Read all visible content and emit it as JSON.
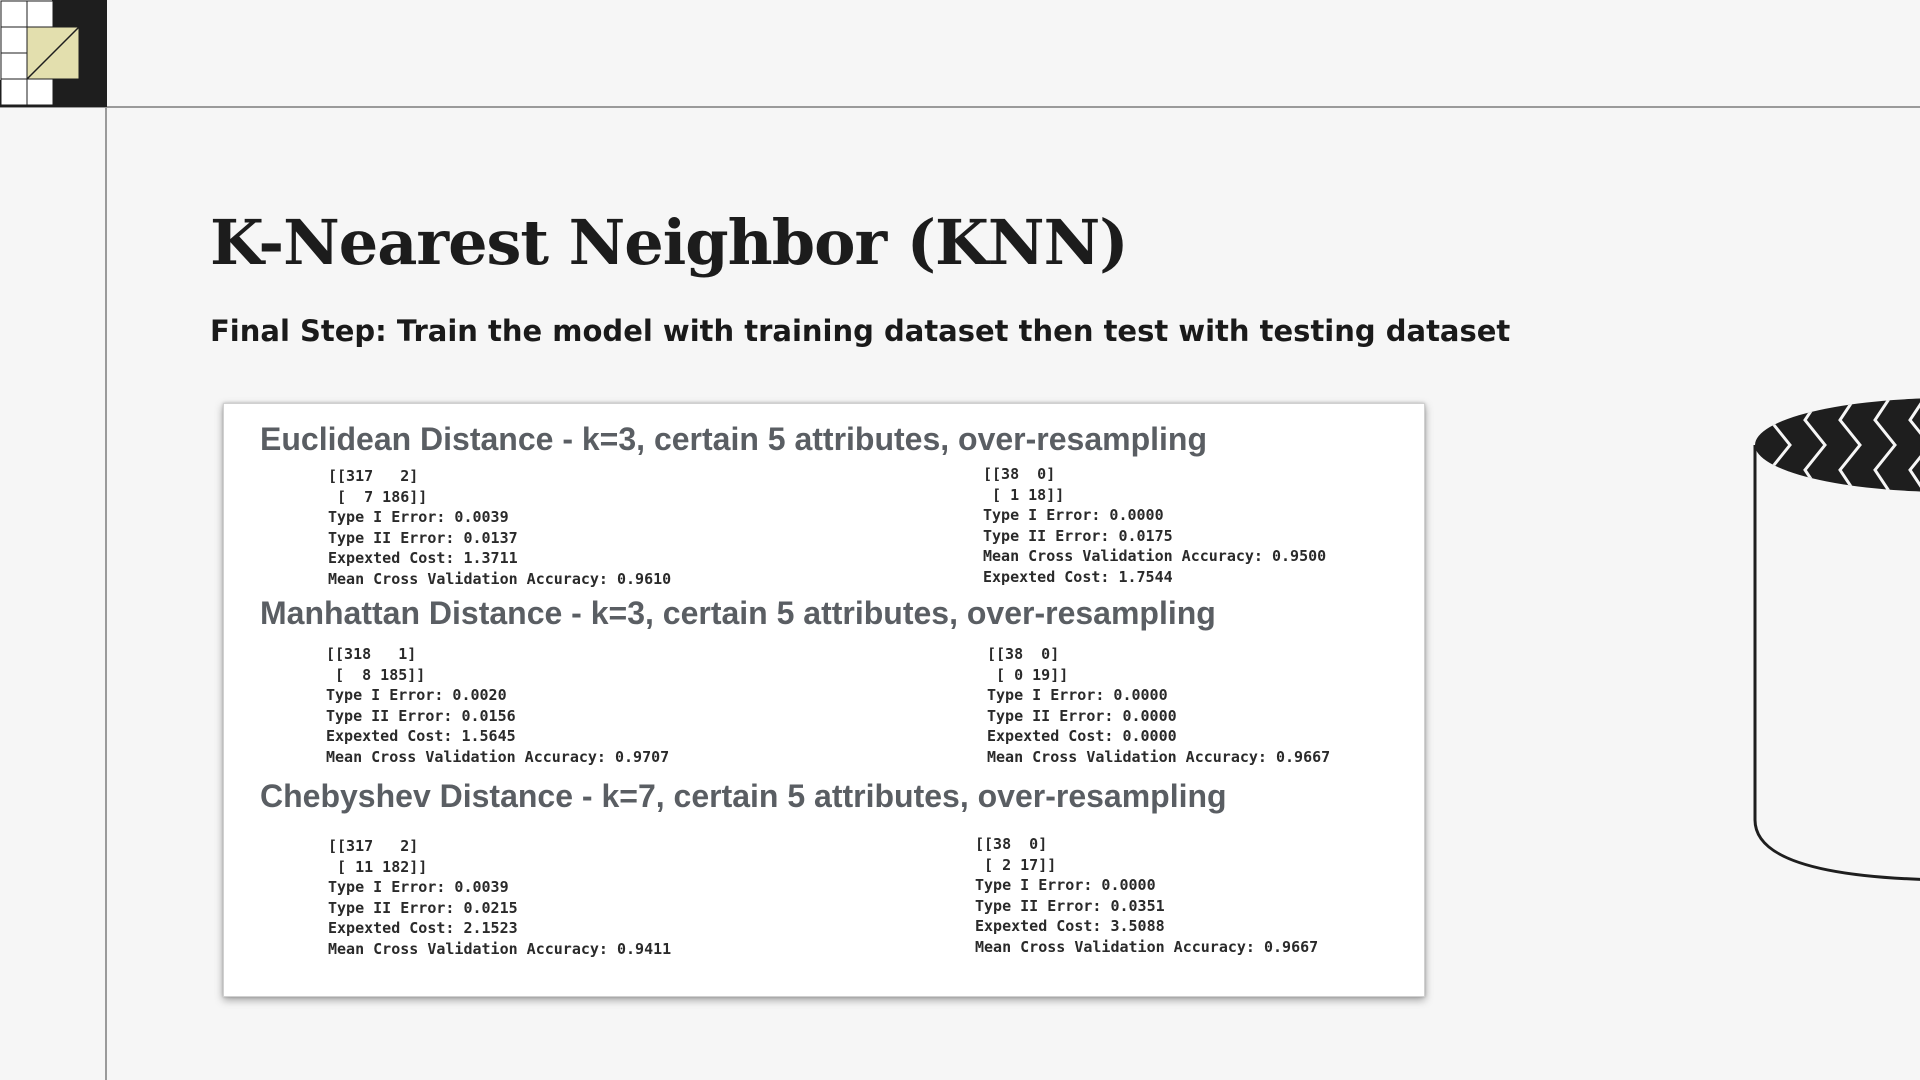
{
  "slide": {
    "title": "K-Nearest Neighbor (KNN)",
    "subtitle": "Final Step: Train the model with training dataset then test with testing dataset"
  },
  "results": {
    "euclidean": {
      "heading": "Euclidean Distance - k=3, certain 5 attributes, over-resampling",
      "left_output": "[[317   2]\n [  7 186]]\nType I Error: 0.0039\nType II Error: 0.0137\nExpexted Cost: 1.3711\nMean Cross Validation Accuracy: 0.9610",
      "right_output": "[[38  0]\n [ 1 18]]\nType I Error: 0.0000\nType II Error: 0.0175\nMean Cross Validation Accuracy: 0.9500\nExpexted Cost: 1.7544"
    },
    "manhattan": {
      "heading": "Manhattan Distance - k=3, certain 5 attributes, over-resampling",
      "left_output": "[[318   1]\n [  8 185]]\nType I Error: 0.0020\nType II Error: 0.0156\nExpexted Cost: 1.5645\nMean Cross Validation Accuracy: 0.9707",
      "right_output": "[[38  0]\n [ 0 19]]\nType I Error: 0.0000\nType II Error: 0.0000\nExpexted Cost: 0.0000\nMean Cross Validation Accuracy: 0.9667"
    },
    "chebyshev": {
      "heading": "Chebyshev Distance - k=7, certain 5 attributes, over-resampling",
      "left_output": "[[317   2]\n [ 11 182]]\nType I Error: 0.0039\nType II Error: 0.0215\nExpexted Cost: 2.1523\nMean Cross Validation Accuracy: 0.9411",
      "right_output": "[[38  0]\n [ 2 17]]\nType I Error: 0.0000\nType II Error: 0.0351\nExpexted Cost: 3.5088\nMean Cross Validation Accuracy: 0.9667"
    }
  },
  "decorations": {
    "corner_icon": "grid-corner-icon",
    "cylinder_icon": "database-cylinder-icon",
    "accent_color": "#e3dfae",
    "dark_color": "#222222"
  }
}
